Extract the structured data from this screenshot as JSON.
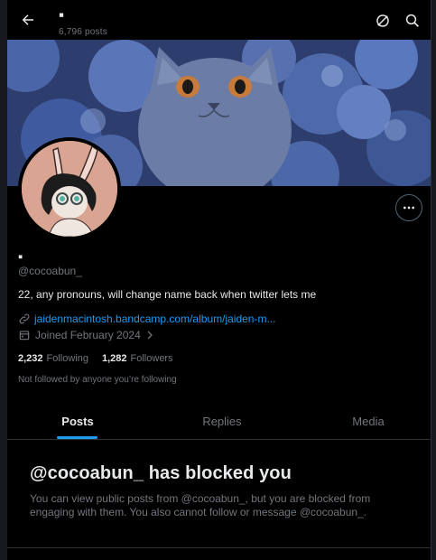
{
  "header": {
    "title": "▪",
    "post_count": "6,796 posts"
  },
  "profile": {
    "display_name": "▪",
    "handle": "@cocoabun_",
    "bio": "22, any pronouns, will change name back when twitter lets me",
    "link": "jaidenmacintosh.bandcamp.com/album/jaiden-m...",
    "joined": "Joined February 2024",
    "following_count": "2,232",
    "following_label": "Following",
    "followers_count": "1,282",
    "followers_label": "Followers",
    "not_followed": "Not followed by anyone you’re following"
  },
  "tabs": [
    {
      "label": "Posts",
      "active": true
    },
    {
      "label": "Replies",
      "active": false
    },
    {
      "label": "Media",
      "active": false
    }
  ],
  "blocked": {
    "title": "@cocoabun_ has blocked you",
    "description": "You can view public posts from @cocoabun_, but you are blocked from engaging with them. You also cannot follow or message @cocoabun_."
  },
  "icons": {
    "back": "arrow-left-icon",
    "refresh": "refresh-icon",
    "search": "search-icon",
    "more": "more-icon",
    "link": "link-icon",
    "calendar": "calendar-icon",
    "chevron": "chevron-right-icon"
  },
  "colors": {
    "background": "#000000",
    "accent": "#1d9bf0",
    "text_primary": "#e7e9ea",
    "text_secondary": "#71767b",
    "border": "#2f3336"
  }
}
